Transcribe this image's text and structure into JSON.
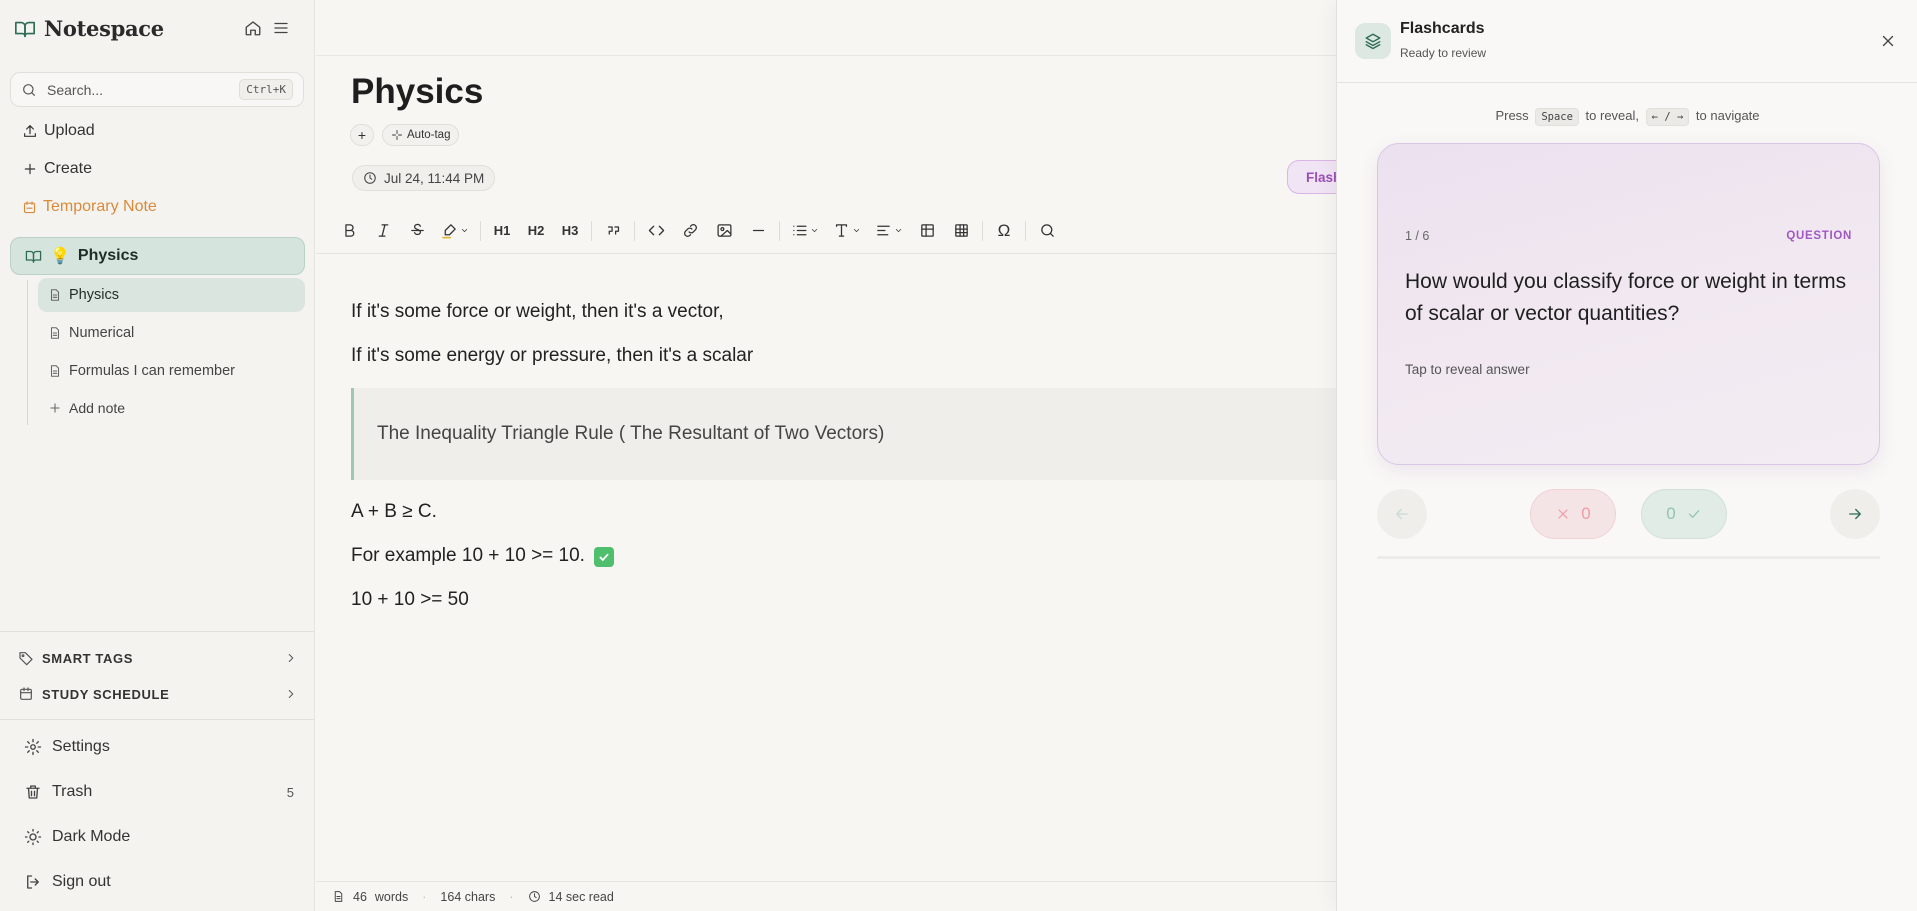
{
  "app": {
    "name": "Notespace"
  },
  "sidebar": {
    "search_placeholder": "Search...",
    "search_shortcut": "Ctrl+K",
    "upload": "Upload",
    "create": "Create",
    "temporary_note": "Temporary Note",
    "notebook": {
      "emoji": "💡",
      "name": "Physics"
    },
    "notes": [
      {
        "label": "Physics"
      },
      {
        "label": "Numerical"
      },
      {
        "label": "Formulas I can remember"
      }
    ],
    "add_note": "Add note",
    "smart_tags": "SMART TAGS",
    "study_schedule": "STUDY SCHEDULE",
    "settings": "Settings",
    "trash": "Trash",
    "trash_count": "5",
    "dark_mode": "Dark Mode",
    "sign_out": "Sign out"
  },
  "editor": {
    "title": "Physics",
    "add_tag": "+",
    "auto_tag": "Auto-tag",
    "date": "Jul 24, 11:44 PM",
    "flashcards_chip": "Flashcards",
    "toolbar": {
      "h1": "H1",
      "h2": "H2",
      "h3": "H3",
      "special": "Ω"
    },
    "lines": [
      "If it's some force or weight, then it's a vector,",
      "If it's some energy or pressure, then it's a scalar"
    ],
    "quote": "The Inequality Triangle Rule ( The Resultant of Two Vectors)",
    "lines2": [
      "A + B ≥ C.",
      "For example 10 + 10 >= 10.",
      "10 + 10 >= 50"
    ],
    "status": {
      "words": "46",
      "words_label": "words",
      "chars": "164 chars",
      "read": "14 sec read"
    }
  },
  "flashcards": {
    "title": "Flashcards",
    "subtitle": "Ready to review",
    "hint": {
      "press": "Press",
      "key1": "Space",
      "to_reveal": "to reveal,",
      "key2": "←",
      "slash": "/",
      "key3": "→",
      "to_navigate": "to navigate"
    },
    "card": {
      "position": "1 / 6",
      "label": "QUESTION",
      "question": "How would you classify force or weight in terms of scalar or vector quantities?",
      "tap": "Tap to reveal answer"
    },
    "wrong_count": "0",
    "right_count": "0"
  },
  "colors": {
    "accent": "#2f6b55",
    "notebook_bg": "#d5e4dc",
    "temporary": "#d98a3a",
    "flashcard_purple": "#a058c2"
  }
}
